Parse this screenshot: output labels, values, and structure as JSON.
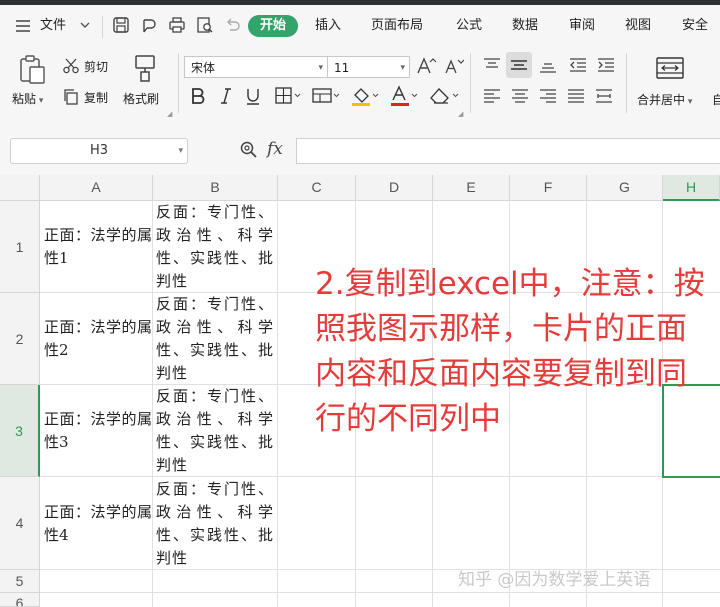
{
  "menubar": {
    "file_label": "文件",
    "tabs": [
      "开始",
      "插入",
      "页面布局",
      "公式",
      "数据",
      "审阅",
      "视图",
      "安全"
    ],
    "active_tab": "开始",
    "active_color": "#33a46a"
  },
  "ribbon": {
    "paste": "粘贴",
    "cut": "剪切",
    "copy": "复制",
    "format_painter": "格式刷",
    "font_name": "宋体",
    "font_size": "11",
    "merge_center": "合并居中",
    "overflow_label": "自"
  },
  "formula_bar": {
    "name_box": "H3",
    "fx": "fx",
    "value": ""
  },
  "sheet": {
    "columns": [
      "A",
      "B",
      "C",
      "D",
      "E",
      "F",
      "G",
      "H"
    ],
    "rows": [
      "1",
      "2",
      "3",
      "4",
      "5",
      "6"
    ],
    "selected_cell": "H3",
    "cells": [
      {
        "a": "正面：法学的属性1",
        "b": "反面：专门性、政治性、科学性、实践性、批判性"
      },
      {
        "a": "正面：法学的属性2",
        "b": "反面：专门性、政治性、科学性、实践性、批判性"
      },
      {
        "a": "正面：法学的属性3",
        "b": "反面：专门性、政治性、科学性、实践性、批判性"
      },
      {
        "a": "正面：法学的属性4",
        "b": "反面：专门性、政治性、科学性、实践性、批判性"
      }
    ]
  },
  "annotation": {
    "text": "2.复制到excel中，注意：按照我图示那样，卡片的正面内容和反面内容要复制到同行的不同列中",
    "color": "#e63b3b"
  },
  "watermark": "知乎 @因为数学爱上英语"
}
